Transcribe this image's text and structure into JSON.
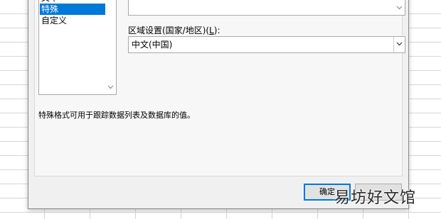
{
  "category_list": {
    "items": [
      "文本",
      "特殊",
      "自定义"
    ],
    "selected_index": 1
  },
  "region": {
    "label_prefix": "区域设置(国家/地区)(",
    "label_accel": "L",
    "label_suffix": "):",
    "selected_value": "中文(中国)"
  },
  "description": "特殊格式可用于跟踪数据列表及数据库的值。",
  "buttons": {
    "ok_label": "确定"
  },
  "watermark": "易坊好文馆",
  "colors": {
    "selection": "#0078d7",
    "dialog_bg": "#f0f0f0"
  },
  "icons": {
    "scroll_up": "chevron-up-icon",
    "scroll_down": "chevron-down-icon",
    "dropdown": "chevron-down-icon"
  }
}
